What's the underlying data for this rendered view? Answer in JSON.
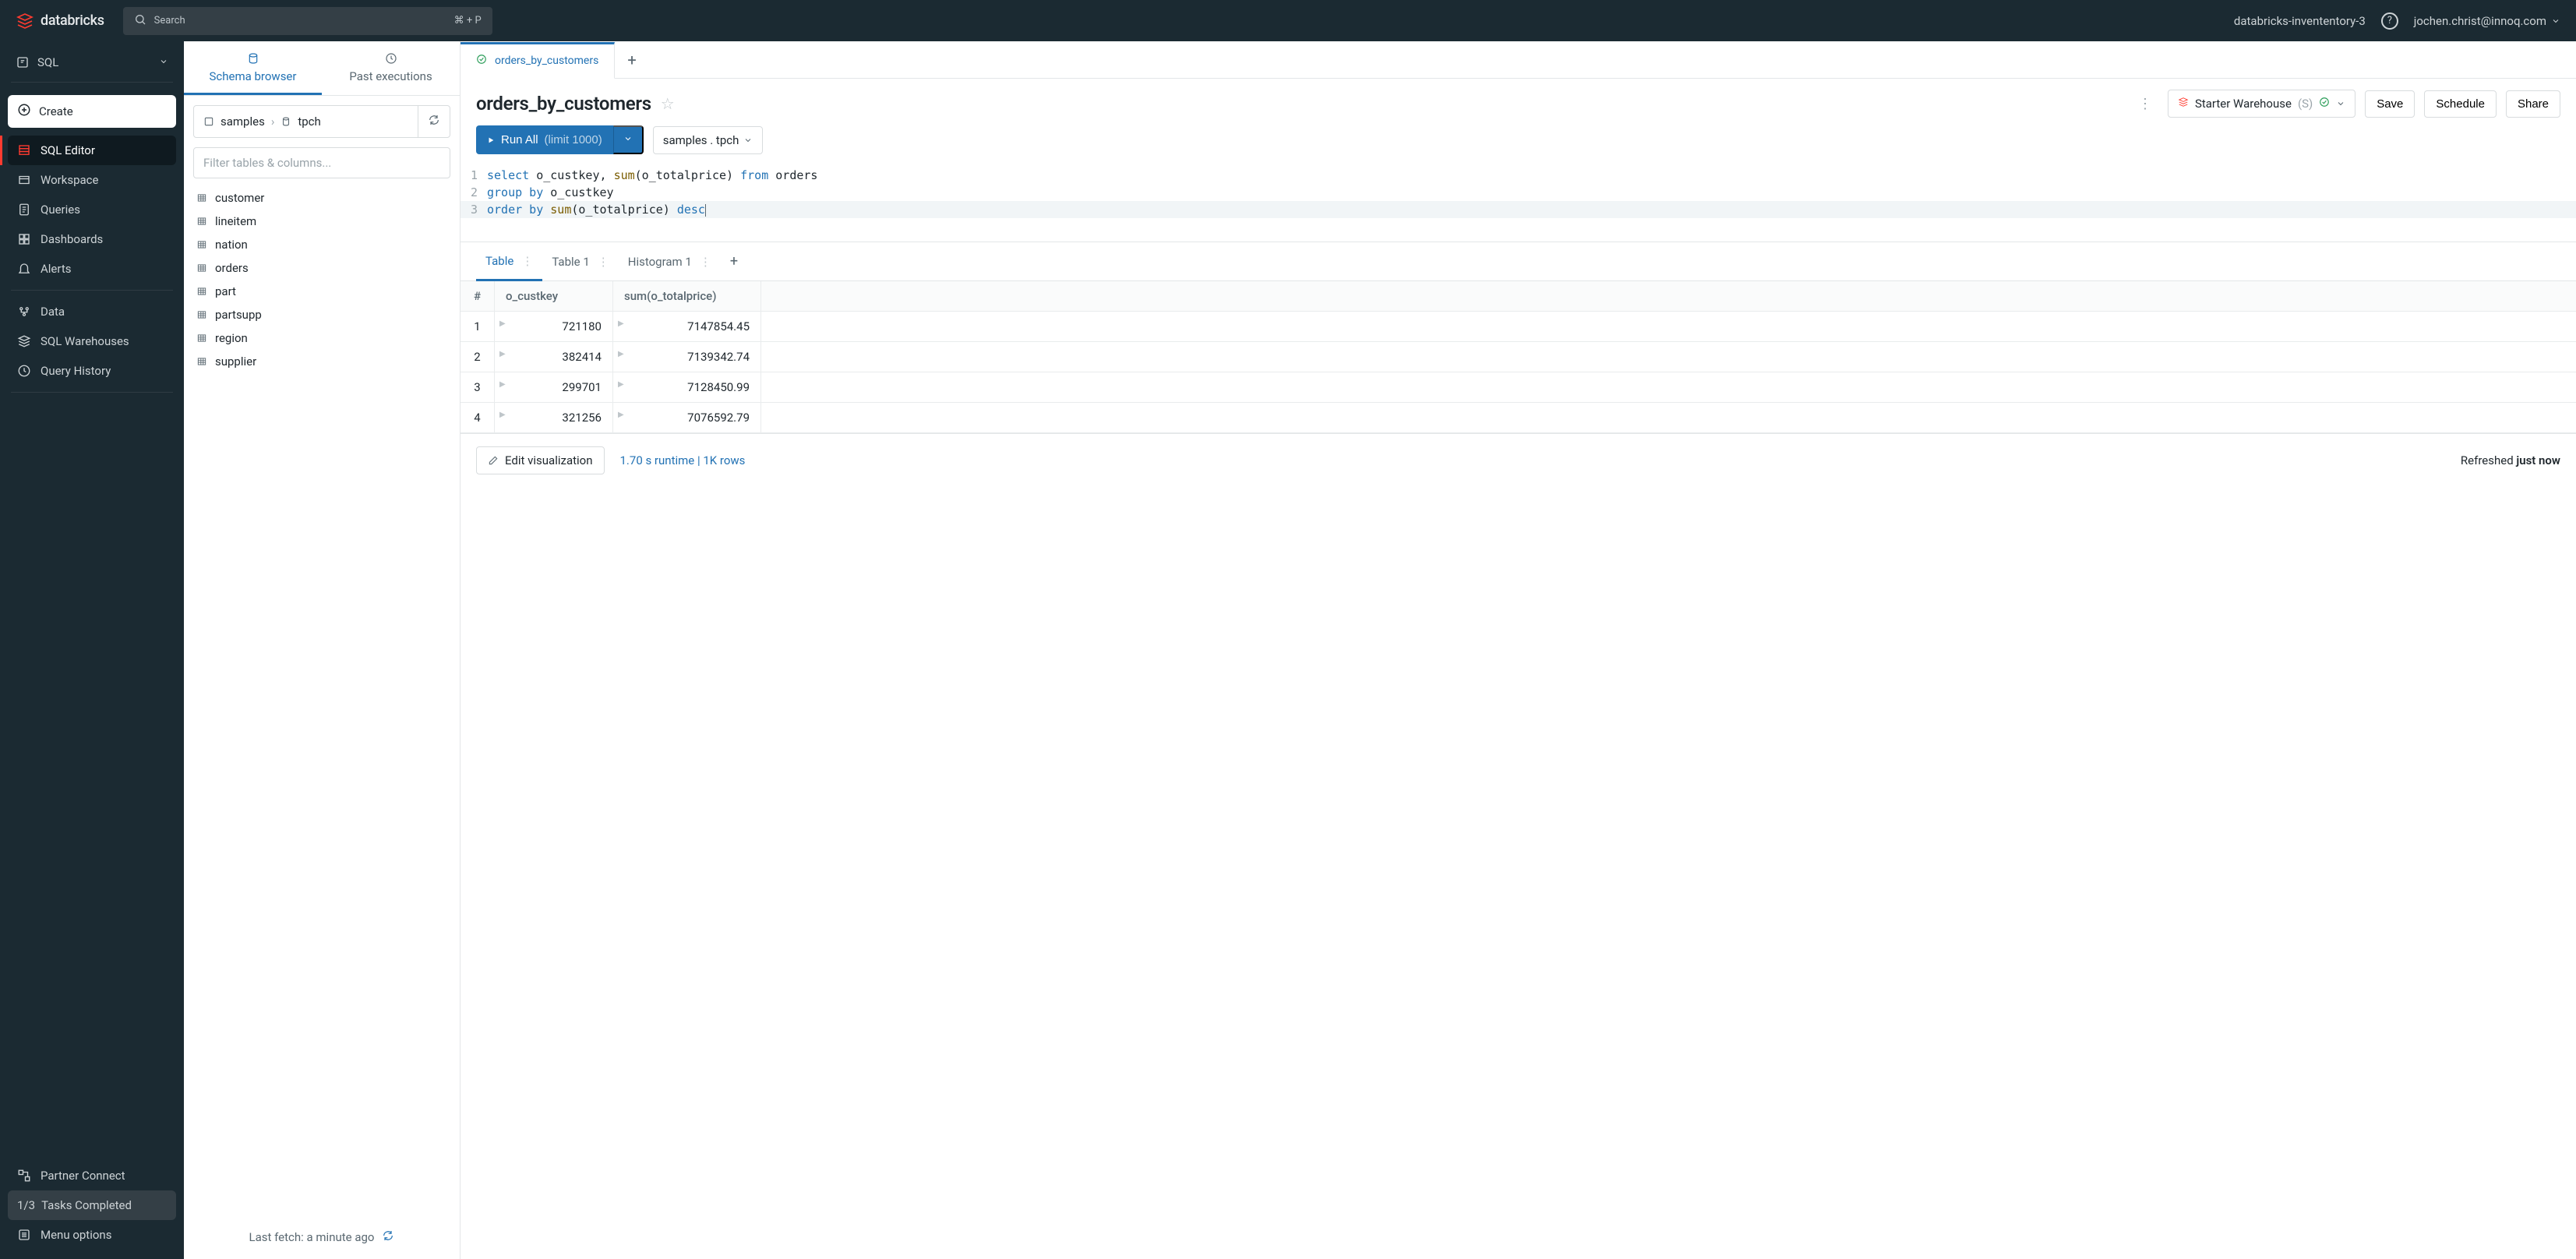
{
  "topbar": {
    "brand": "databricks",
    "search_placeholder": "Search",
    "search_shortcut": "⌘ + P",
    "workspace_name": "databricks-invententory-3",
    "user_email": "jochen.christ@innoq.com"
  },
  "leftnav": {
    "persona": "SQL",
    "create_label": "Create",
    "items_top": [
      {
        "label": "SQL Editor",
        "active": true
      },
      {
        "label": "Workspace"
      },
      {
        "label": "Queries"
      },
      {
        "label": "Dashboards"
      },
      {
        "label": "Alerts"
      }
    ],
    "items_mid": [
      {
        "label": "Data"
      },
      {
        "label": "SQL Warehouses"
      },
      {
        "label": "Query History"
      }
    ],
    "partner_connect": "Partner Connect",
    "tasks_count": "1/3",
    "tasks_label": "Tasks Completed",
    "menu_options": "Menu options"
  },
  "browser": {
    "tabs": {
      "schema": "Schema browser",
      "past": "Past executions"
    },
    "crumb": {
      "catalog": "samples",
      "schema": "tpch"
    },
    "filter_placeholder": "Filter tables & columns...",
    "tables": [
      "customer",
      "lineitem",
      "nation",
      "orders",
      "part",
      "partsupp",
      "region",
      "supplier"
    ],
    "last_fetch": "Last fetch: a minute ago"
  },
  "editor": {
    "tab_name": "orders_by_customers",
    "title": "orders_by_customers",
    "warehouse": {
      "name": "Starter Warehouse",
      "size": "(S)"
    },
    "buttons": {
      "save": "Save",
      "schedule": "Schedule",
      "share": "Share"
    },
    "run": {
      "label": "Run All",
      "limit": "(limit 1000)"
    },
    "context": "samples . tpch",
    "code": [
      {
        "tokens": [
          {
            "t": "select",
            "c": "kw"
          },
          {
            "t": " o_custkey, "
          },
          {
            "t": "sum",
            "c": "fn"
          },
          {
            "t": "(o_totalprice) "
          },
          {
            "t": "from",
            "c": "kw"
          },
          {
            "t": " orders"
          }
        ]
      },
      {
        "tokens": [
          {
            "t": "group by",
            "c": "kw"
          },
          {
            "t": " o_custkey"
          }
        ]
      },
      {
        "sel": true,
        "tokens": [
          {
            "t": "order by",
            "c": "kw"
          },
          {
            "t": " "
          },
          {
            "t": "sum",
            "c": "fn"
          },
          {
            "t": "(o_totalprice) "
          },
          {
            "t": "desc",
            "c": "kw"
          }
        ]
      }
    ]
  },
  "results": {
    "tabs": [
      "Table",
      "Table 1",
      "Histogram 1"
    ],
    "columns": [
      "#",
      "o_custkey",
      "sum(o_totalprice)"
    ],
    "rows": [
      {
        "i": 1,
        "k": "721180",
        "s": "7147854.45"
      },
      {
        "i": 2,
        "k": "382414",
        "s": "7139342.74"
      },
      {
        "i": 3,
        "k": "299701",
        "s": "7128450.99"
      },
      {
        "i": 4,
        "k": "321256",
        "s": "7076592.79"
      }
    ],
    "edit_viz": "Edit visualization",
    "runtime": "1.70 s runtime  |  1K rows",
    "refreshed_prefix": "Refreshed ",
    "refreshed_value": "just now"
  }
}
